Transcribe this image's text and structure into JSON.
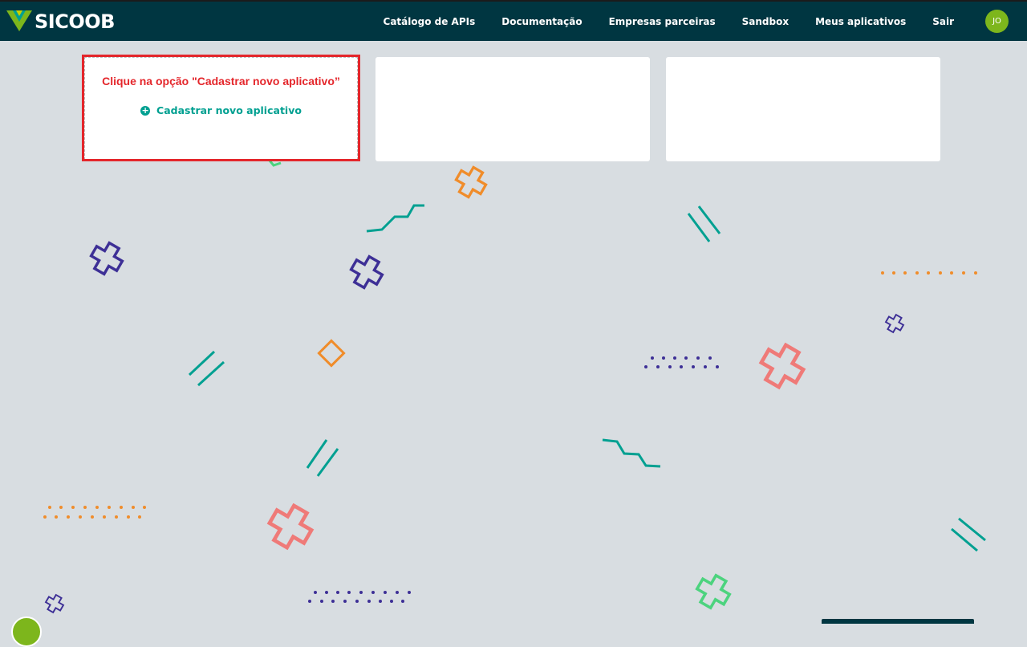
{
  "header": {
    "logo_text": "SICOOB",
    "nav": [
      "Catálogo de APIs",
      "Documentação",
      "Empresas parceiras",
      "Sandbox",
      "Meus aplicativos",
      "Sair"
    ],
    "avatar_initials": "JO"
  },
  "main": {
    "hint_text": "Clique na opção \"Cadastrar novo aplicativo”",
    "new_app_label": "Cadastrar novo aplicativo"
  },
  "colors": {
    "header_bg": "#003641",
    "accent_teal": "#00a091",
    "highlight_red": "#e4262b",
    "avatar_green": "#7db61c",
    "page_bg": "#d8dde1"
  }
}
